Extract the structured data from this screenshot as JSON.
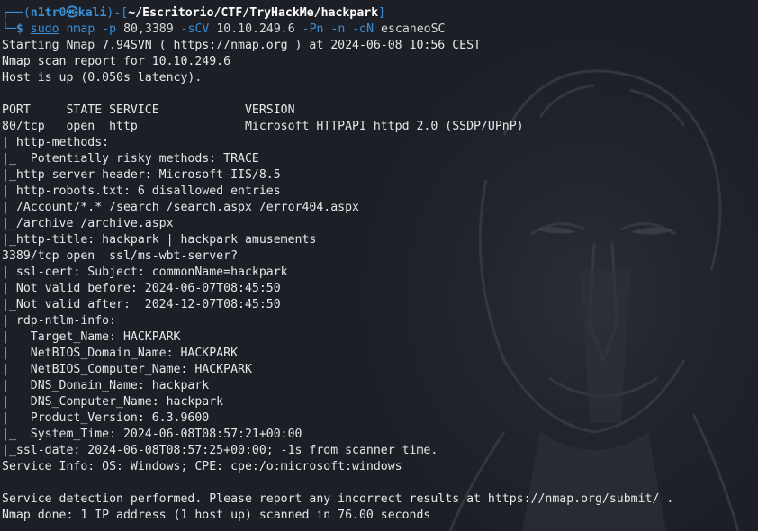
{
  "prompt": {
    "frame_top_left": "┌──(",
    "user": "n1tr0",
    "at_symbol": "㉿",
    "host": "kali",
    "frame_mid": ")-[",
    "path": "~/Escritorio/CTF/TryHackMe/hackpark",
    "frame_end": "]",
    "frame_bottom": "└─",
    "dollar": "$",
    "cmd_sudo": "sudo",
    "cmd_nmap": "nmap",
    "cmd_flag_p": "-p",
    "cmd_ports": "80,3389",
    "cmd_flag_scv": "-sCV",
    "cmd_ip": "10.10.249.6",
    "cmd_flag_pn": "-Pn",
    "cmd_flag_n": "-n",
    "cmd_flag_on": "-oN",
    "cmd_outfile": "escaneoSC"
  },
  "output_lines": [
    "Starting Nmap 7.94SVN ( https://nmap.org ) at 2024-06-08 10:56 CEST",
    "Nmap scan report for 10.10.249.6",
    "Host is up (0.050s latency).",
    "",
    "PORT     STATE SERVICE            VERSION",
    "80/tcp   open  http               Microsoft HTTPAPI httpd 2.0 (SSDP/UPnP)",
    "| http-methods: ",
    "|_  Potentially risky methods: TRACE",
    "|_http-server-header: Microsoft-IIS/8.5",
    "| http-robots.txt: 6 disallowed entries ",
    "| /Account/*.* /search /search.aspx /error404.aspx ",
    "|_/archive /archive.aspx",
    "|_http-title: hackpark | hackpark amusements",
    "3389/tcp open  ssl/ms-wbt-server?",
    "| ssl-cert: Subject: commonName=hackpark",
    "| Not valid before: 2024-06-07T08:45:50",
    "|_Not valid after:  2024-12-07T08:45:50",
    "| rdp-ntlm-info: ",
    "|   Target_Name: HACKPARK",
    "|   NetBIOS_Domain_Name: HACKPARK",
    "|   NetBIOS_Computer_Name: HACKPARK",
    "|   DNS_Domain_Name: hackpark",
    "|   DNS_Computer_Name: hackpark",
    "|   Product_Version: 6.3.9600",
    "|_  System_Time: 2024-06-08T08:57:21+00:00",
    "|_ssl-date: 2024-06-08T08:57:25+00:00; -1s from scanner time.",
    "Service Info: OS: Windows; CPE: cpe:/o:microsoft:windows",
    "",
    "Service detection performed. Please report any incorrect results at https://nmap.org/submit/ .",
    "Nmap done: 1 IP address (1 host up) scanned in 76.00 seconds"
  ],
  "colors": {
    "background": "#1c1f26",
    "prompt_blue": "#3a8fd6",
    "text": "#e6e6e6"
  },
  "wallpaper": {
    "subject": "anime-character-face-watermark"
  }
}
